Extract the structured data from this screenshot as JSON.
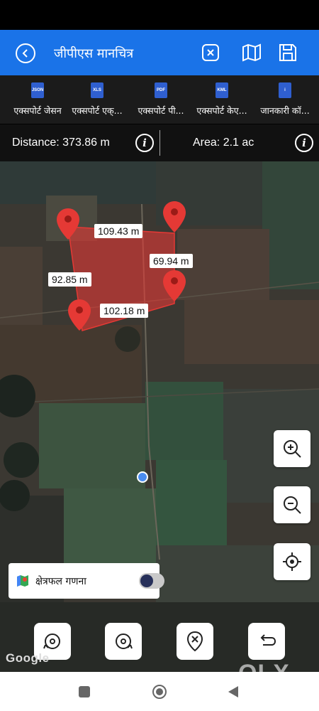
{
  "appbar": {
    "title": "जीपीएस मानचित्र"
  },
  "exports": [
    {
      "icon_text": "JSON",
      "label": "एक्सपोर्ट जेसन",
      "color": "#2f5fd0"
    },
    {
      "icon_text": "XLS",
      "label": "एक्सपोर्ट एक्...",
      "color": "#2f5fd0"
    },
    {
      "icon_text": "PDF",
      "label": "एक्सपोर्ट पी...",
      "color": "#2f5fd0"
    },
    {
      "icon_text": "KML",
      "label": "एक्सपोर्ट केए...",
      "color": "#2f5fd0"
    },
    {
      "icon_text": "i",
      "label": "जानकारी कॉ...",
      "color": "#2f5fd0"
    }
  ],
  "metrics": {
    "distance": "Distance: 373.86 m",
    "area": "Area: 2.1 ac"
  },
  "map": {
    "labels": [
      "109.43 m",
      "69.94 m",
      "92.85 m",
      "102.18 m"
    ],
    "area_calc_label": "क्षेत्रफल गणना",
    "google_logo": "Google"
  },
  "watermark": "OLX",
  "colors": {
    "accent": "#1a73e8",
    "pin": "#e53935",
    "polygon": "#e53935"
  }
}
